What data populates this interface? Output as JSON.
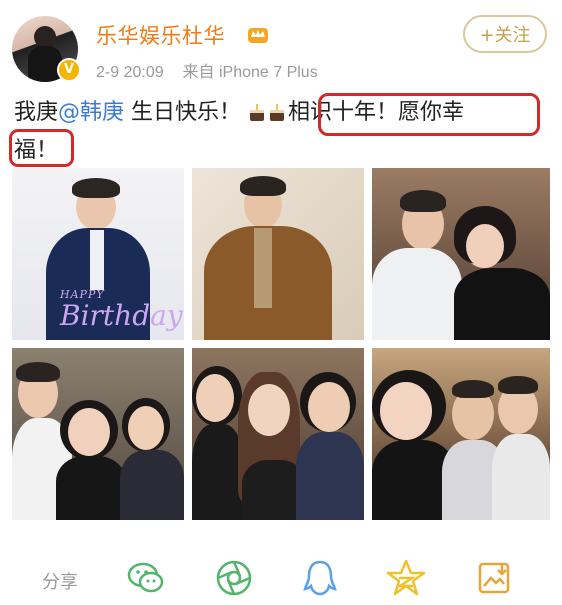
{
  "header": {
    "name": "乐华娱乐杜华",
    "timestamp": "2-9 20:09",
    "source": "来自 iPhone 7 Plus",
    "follow_label": "+关注",
    "verified_badge": "V"
  },
  "post": {
    "text_before": "我庚",
    "mention": "@韩庚",
    "text_birthday": " 生日快乐！",
    "text_highlight": "相识十年！愿你幸",
    "text_end": "福！"
  },
  "photos": [
    {
      "caption_small": "HAPPY",
      "caption_big": "Birthday!"
    },
    {},
    {},
    {},
    {},
    {}
  ],
  "share_bar": {
    "label": "分享",
    "icons": [
      "wechat-icon",
      "moments-icon",
      "qq-icon",
      "qzone-icon",
      "save-image-icon"
    ]
  },
  "colors": {
    "name": "#f07b10",
    "mention": "#3b7bd6",
    "highlight": "#d12a2a",
    "share_icon": "#53b56a",
    "share_qq": "#5aa0e8",
    "share_star": "#f1c12b"
  }
}
